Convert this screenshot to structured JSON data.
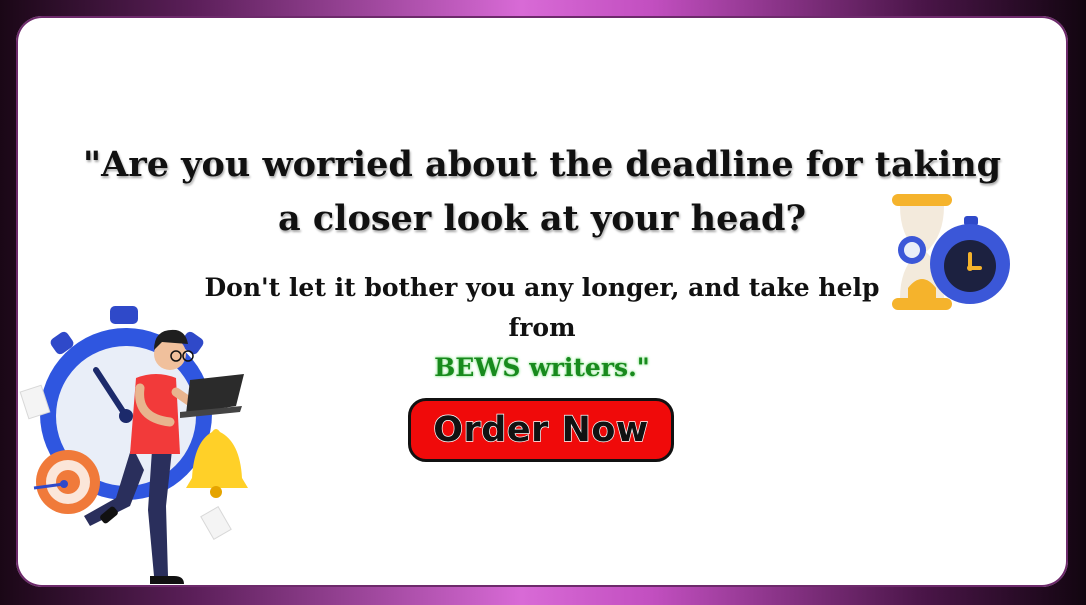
{
  "headline": {
    "line1": "\"Are you worried about the deadline for taking",
    "line2": "a closer look at your head?"
  },
  "subtext": {
    "line1": "Don't let it bother you any longer, and take help",
    "prefix": "from",
    "brand": "BEWS writers.\""
  },
  "cta": {
    "label": "Order Now"
  },
  "colors": {
    "accent": "#f00a0a",
    "brand": "#188a1d",
    "frame": "#c24fc0"
  },
  "icons": [
    "person-laptop-icon",
    "stopwatch-icon",
    "target-icon",
    "bell-icon",
    "hourglass-icon"
  ]
}
